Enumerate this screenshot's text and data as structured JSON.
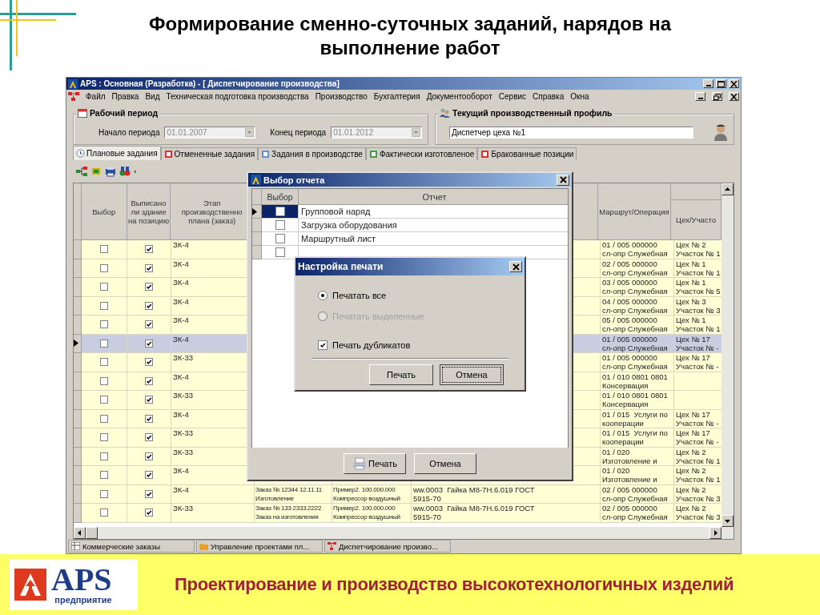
{
  "slide_title": "Формирование сменно-суточных заданий, нарядов на\nвыполнение работ",
  "window": {
    "title": "APS : Основная (Разработка) - [ Диспетчирование производства]"
  },
  "menu": [
    "Файл",
    "Правка",
    "Вид",
    "Техническая подготовка производства",
    "Производство",
    "Бухгалтерия",
    "Документооборот",
    "Сервис",
    "Справка",
    "Окна"
  ],
  "period": {
    "title": "Рабочий период",
    "start_label": "Начало периода",
    "start_value": "01.01.2007",
    "end_label": "Конец периода",
    "end_value": "01.01.2012"
  },
  "profile": {
    "title": "Текущий производственный профиль",
    "value": "Диспетчер цеха №1"
  },
  "tabs": [
    {
      "label": "Плановые задания",
      "selected": true
    },
    {
      "label": "Отмененные задания",
      "selected": false
    },
    {
      "label": "Задания в производстве",
      "selected": false
    },
    {
      "label": "Фактически изготовленое",
      "selected": false
    },
    {
      "label": "Бракованные позиции",
      "selected": false
    }
  ],
  "grid": {
    "columns": [
      "Выбор",
      "Выписано\nли здание\nна позицию",
      "Этап\nпроизводственно\nплана (заказ)",
      "Маршрут/Операция",
      "Цех/Участо"
    ],
    "rows": [
      {
        "select_checked": false,
        "written_checked": true,
        "stage": "ЗК-4",
        "route": "01 / 005 000000\nсл-опр Служебная",
        "shop": "Цех № 2\nУчасток № 1",
        "selected": false
      },
      {
        "select_checked": false,
        "written_checked": true,
        "stage": "ЗК-4",
        "route": "02 / 005 000000\nсл-опр Служебная",
        "shop": "Цех № 1\nУчасток № 1",
        "selected": false
      },
      {
        "select_checked": false,
        "written_checked": true,
        "stage": "ЗК-4",
        "route": "03 / 005 000000\nсл-опр Служебная",
        "shop": "Цех № 1\nУчасток № 5",
        "selected": false
      },
      {
        "select_checked": false,
        "written_checked": true,
        "stage": "ЗК-4",
        "route": "04 / 005 000000\nсл-опр Служебная",
        "shop": "Цех № 3\nУчасток № 3",
        "selected": false
      },
      {
        "select_checked": false,
        "written_checked": true,
        "stage": "ЗК-4",
        "route": "05 / 005 000000\nсл-опр Служебная",
        "shop": "Цех № 1\nУчасток № 1",
        "selected": false
      },
      {
        "select_checked": false,
        "written_checked": true,
        "stage": "ЗК-4",
        "route": "01 / 005 000000\nсл-опр Служебная",
        "shop": "Цех № 17\nУчасток № -",
        "selected": true
      },
      {
        "select_checked": false,
        "written_checked": true,
        "stage": "ЗК-33",
        "route": "01 / 005 000000\nсл-опр Служебная",
        "shop": "Цех № 17\nУчасток № -",
        "selected": false
      },
      {
        "select_checked": false,
        "written_checked": true,
        "stage": "ЗК-4",
        "route": "01 / 010 0801 0801\nКонсервация",
        "selected": false
      },
      {
        "select_checked": false,
        "written_checked": true,
        "stage": "ЗК-33",
        "route": "01 / 010 0801 0801\nКонсервация",
        "selected": false
      },
      {
        "select_checked": false,
        "written_checked": true,
        "stage": "ЗК-4",
        "route": "01 / 015  Услуги по\nкооперации",
        "shop": "Цех № 17\nУчасток № -",
        "selected": false
      },
      {
        "select_checked": false,
        "written_checked": true,
        "stage": "ЗК-33",
        "route": "01 / 015  Услуги по\nкооперации",
        "shop": "Цех № 17\nУчасток № -",
        "selected": false
      },
      {
        "select_checked": false,
        "written_checked": true,
        "stage": "ЗК-33",
        "route": "01 / 020\nИзготовление и",
        "shop": "Цех № 2\nУчасток № 1",
        "selected": false
      },
      {
        "select_checked": false,
        "written_checked": true,
        "stage": "ЗК-4",
        "route": "01 / 020\nИзготовление и",
        "shop": "Цех № 2\nУчасток № 1",
        "selected": false
      },
      {
        "select_checked": false,
        "written_checked": true,
        "stage": "ЗК-4",
        "order": "Заказ № 12344 12.11.11\nИзготовление",
        "product": "Пример2. 100.000.000\nКомпрессор воздушный",
        "item": "ww.0003  Гайка М8-7Н.6.019 ГОСТ\n5915-70",
        "route": "02 / 005 000000\nсл-опр Служебная",
        "shop": "Цех № 2\nУчасток № 3",
        "selected": false
      },
      {
        "select_checked": false,
        "written_checked": true,
        "stage": "ЗК-33",
        "order": "Заказ № 133 2333.2222\nЗаказ на изготовления",
        "product": "Пример2. 100.000.000\nКомпрессор воздушный",
        "item": "ww.0003  Гайка М8-7Н.6.019 ГОСТ\n5915-70",
        "route": "02 / 005 000000\nсл-опр Служебная",
        "shop": "Цех № 2\nУчасток № 3",
        "selected": false
      }
    ]
  },
  "taskbar": [
    "Коммерческие заказы",
    "Управление проектами пл...",
    "Диспетчирование произво..."
  ],
  "report_dialog": {
    "title": "Выбор отчета",
    "columns": [
      "Выбор",
      "Отчет"
    ],
    "rows": [
      {
        "label": "Групповой наряд",
        "checked": false,
        "selected": true
      },
      {
        "label": "Загрузка оборудования",
        "checked": false,
        "selected": false
      },
      {
        "label": "Маршрутный лист",
        "checked": false,
        "selected": false
      },
      {
        "checked": false,
        "selected": false
      }
    ],
    "buttons": [
      {
        "label": "Печать",
        "kind": "print"
      },
      {
        "label": "Отмена",
        "kind": "plain"
      }
    ]
  },
  "print_dialog": {
    "title": "Настройка печати",
    "options": [
      {
        "kind": "radio",
        "label": "Печатать все",
        "selected": true,
        "disabled": false
      },
      {
        "kind": "radio",
        "label": "Печатать выделенные",
        "selected": false,
        "disabled": true
      },
      {
        "kind": "checkbox",
        "label": "Печать дубликатов",
        "checked": true
      }
    ],
    "buttons": [
      {
        "label": "Печать",
        "focused": false
      },
      {
        "label": "Отмена",
        "focused": true
      }
    ]
  },
  "footer": {
    "brand": "APS",
    "brand_subtitle": "предприятие",
    "slogan": "Проектирование и производство высокотехнологичных изделий"
  }
}
